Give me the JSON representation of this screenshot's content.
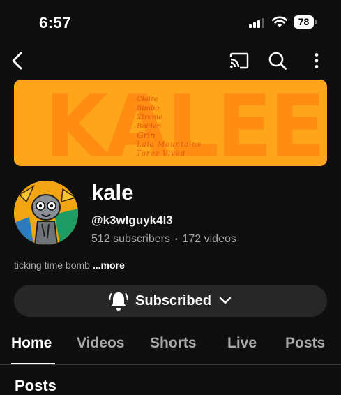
{
  "status_bar": {
    "time": "6:57",
    "battery": "78"
  },
  "icons": {
    "back": "back-arrow-icon",
    "cast": "cast-icon",
    "search": "search-icon",
    "more": "more-vertical-icon",
    "bell": "bell-icon",
    "chevron": "chevron-down-icon"
  },
  "banner": {
    "title": "KALEEE",
    "lines": [
      "Claire",
      "Bimbo",
      "Xtreme",
      "Boiden",
      "Grin",
      "Lala Mountains",
      "Torez Vived"
    ]
  },
  "channel": {
    "name": "kale",
    "handle": "@k3wlguyk4l3",
    "subscribers": "512 subscribers",
    "separator": "•",
    "videos": "172 videos",
    "description": "ticking time bomb ",
    "more": "...more"
  },
  "subscribe": {
    "label": "Subscribed"
  },
  "tabs": [
    "Home",
    "Videos",
    "Shorts",
    "Live",
    "Posts"
  ],
  "section": {
    "heading": "Posts"
  },
  "colors": {
    "background": "#0f0f0f",
    "button": "#272727",
    "banner": "#ffa51a",
    "muted_text": "#aaaaaa"
  }
}
